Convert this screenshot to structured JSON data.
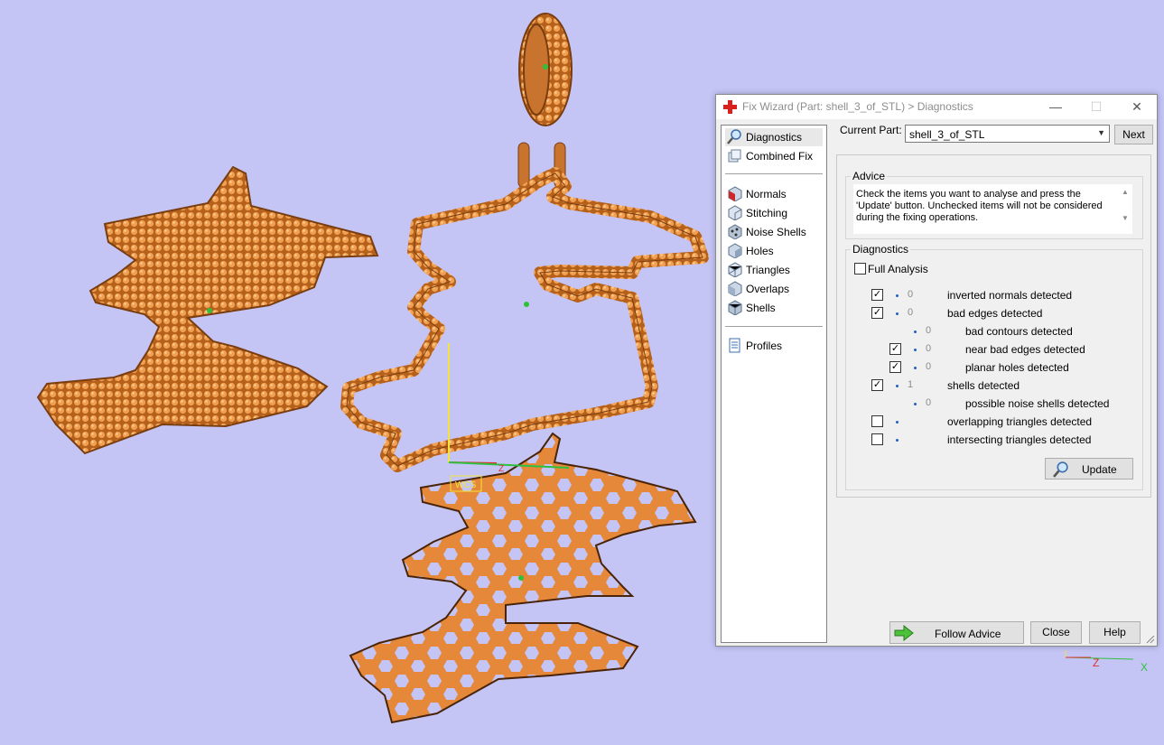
{
  "window": {
    "title": "Fix Wizard (Part: shell_3_of_STL) > Diagnostics",
    "minimize": "—",
    "maximize": "☐",
    "close": "✕"
  },
  "sidebar": {
    "items": [
      {
        "label": "Diagnostics",
        "icon": "magnifier-icon"
      },
      {
        "label": "Combined Fix",
        "icon": "combined-fix-icon"
      },
      {
        "label": "Normals",
        "icon": "normals-cube-icon"
      },
      {
        "label": "Stitching",
        "icon": "stitching-cube-icon"
      },
      {
        "label": "Noise Shells",
        "icon": "noise-shells-icon"
      },
      {
        "label": "Holes",
        "icon": "holes-cube-icon"
      },
      {
        "label": "Triangles",
        "icon": "triangles-cube-icon"
      },
      {
        "label": "Overlaps",
        "icon": "overlaps-cube-icon"
      },
      {
        "label": "Shells",
        "icon": "shells-cube-icon"
      },
      {
        "label": "Profiles",
        "icon": "document-icon"
      }
    ]
  },
  "current_part": {
    "label": "Current Part:",
    "value": "shell_3_of_STL",
    "next_label": "Next"
  },
  "advice": {
    "title": "Advice",
    "text": "Check the items you want to analyse and press the 'Update' button. Unchecked items will not be considered during the fixing operations."
  },
  "diagnostics": {
    "title": "Diagnostics",
    "full_analysis_label": "Full Analysis",
    "full_analysis_checked": false,
    "rows": [
      {
        "checked": true,
        "count": "0",
        "label": "inverted normals detected"
      },
      {
        "checked": true,
        "count": "0",
        "label": "bad edges detected"
      },
      {
        "checked": null,
        "count": "0",
        "label": "bad contours detected"
      },
      {
        "checked": true,
        "count": "0",
        "label": "near bad edges detected"
      },
      {
        "checked": true,
        "count": "0",
        "label": "planar holes detected"
      },
      {
        "checked": true,
        "count": "1",
        "label": "shells detected"
      },
      {
        "checked": null,
        "count": "0",
        "label": "possible noise shells detected"
      },
      {
        "checked": false,
        "count": "",
        "label": "overlapping triangles detected"
      },
      {
        "checked": false,
        "count": "",
        "label": "intersecting triangles detected"
      }
    ],
    "update_label": "Update"
  },
  "footer": {
    "follow_advice_label": "Follow Advice",
    "close_label": "Close",
    "help_label": "Help"
  },
  "viewport": {
    "wcs_label": "WCS",
    "axis_z": "Z",
    "corner_axis_z": "Z",
    "corner_axis_x": "X",
    "part_color": "#e08a3a",
    "background_color": "#c4c4f5"
  }
}
